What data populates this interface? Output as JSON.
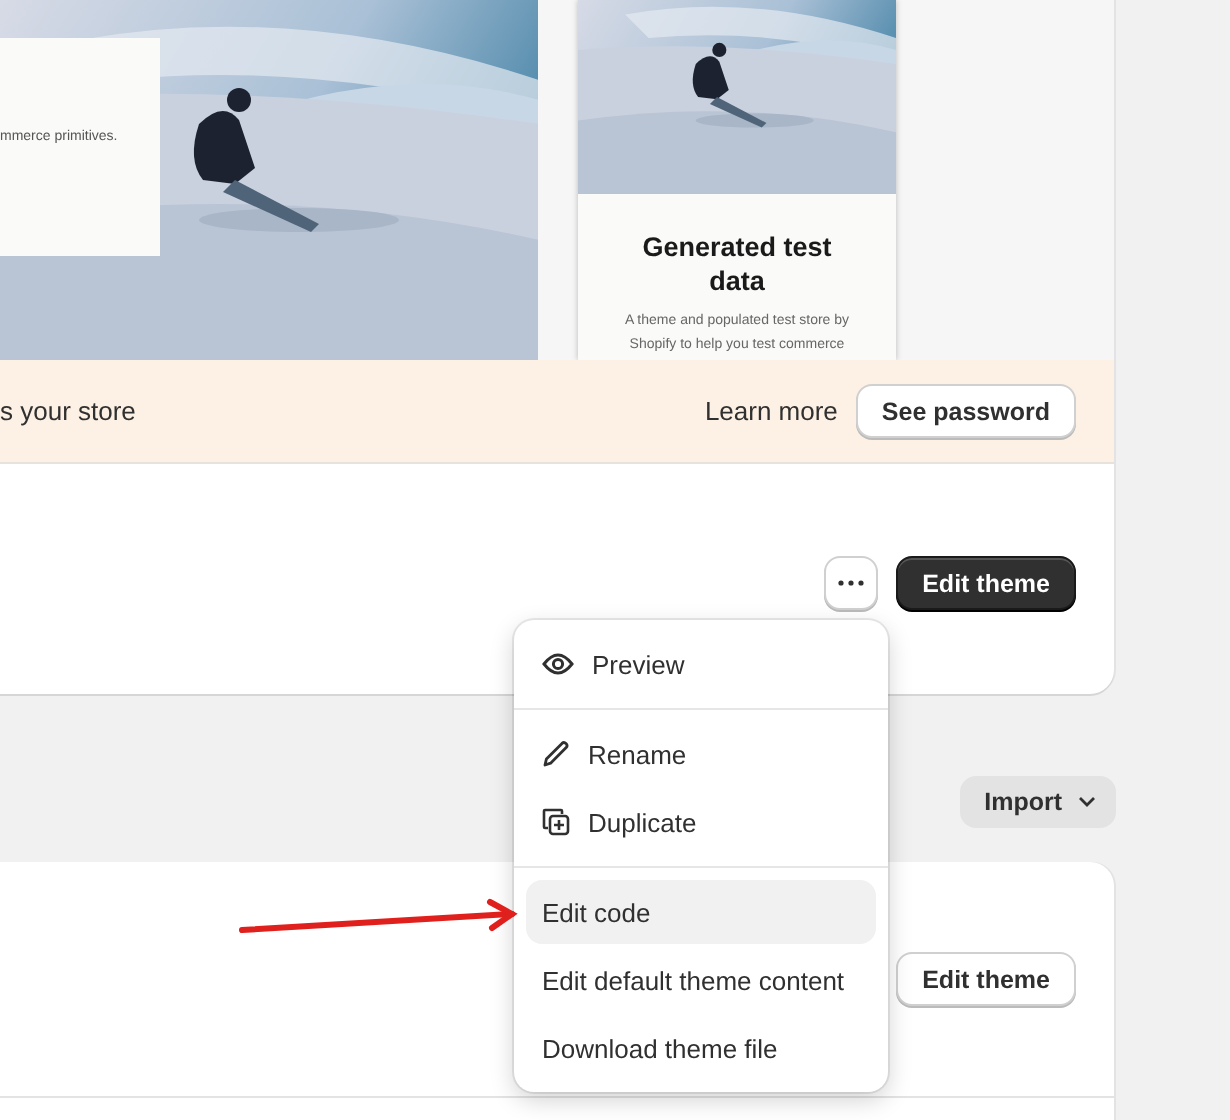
{
  "desktop_preview": {
    "overlay_text": "mmerce primitives."
  },
  "mobile_preview": {
    "title": "Generated test data",
    "description": "A theme and populated test store by Shopify to help you test commerce"
  },
  "banner": {
    "text": "s your store",
    "link": "Learn more",
    "button": "See password"
  },
  "current_theme": {
    "button": "Edit theme"
  },
  "library": {
    "import_button": "Import"
  },
  "theme_row": {
    "button": "Edit theme"
  },
  "menu": {
    "sections": [
      [
        {
          "label": "Preview",
          "kind": "preview",
          "selected": false
        }
      ],
      [
        {
          "label": "Rename",
          "kind": "rename",
          "selected": false
        },
        {
          "label": "Duplicate",
          "kind": "duplicate",
          "selected": false
        }
      ],
      [
        {
          "label": "Edit code",
          "kind": "plain",
          "selected": true
        },
        {
          "label": "Edit default theme content",
          "kind": "plain",
          "selected": false
        },
        {
          "label": "Download theme file",
          "kind": "plain",
          "selected": false
        }
      ]
    ]
  }
}
